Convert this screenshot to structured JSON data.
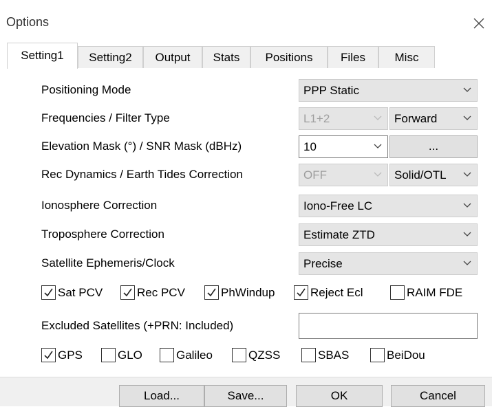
{
  "window": {
    "title": "Options"
  },
  "tabs": [
    "Setting1",
    "Setting2",
    "Output",
    "Stats",
    "Positions",
    "Files",
    "Misc"
  ],
  "settings": {
    "positioning_mode": {
      "label": "Positioning Mode",
      "value": "PPP Static"
    },
    "frequencies": {
      "label": "Frequencies / Filter Type",
      "freq_value": "L1+2",
      "filter_value": "Forward"
    },
    "elevation": {
      "label": "Elevation Mask (°) / SNR Mask (dBHz)",
      "value": "10",
      "snr_button": "..."
    },
    "dynamics": {
      "label": "Rec Dynamics / Earth Tides Correction",
      "dyn_value": "OFF",
      "tides_value": "Solid/OTL"
    },
    "ionosphere": {
      "label": "Ionosphere Correction",
      "value": "Iono-Free LC"
    },
    "troposphere": {
      "label": "Troposphere Correction",
      "value": "Estimate ZTD"
    },
    "ephemeris": {
      "label": "Satellite Ephemeris/Clock",
      "value": "Precise"
    }
  },
  "options_checks": [
    {
      "label": "Sat PCV",
      "checked": true
    },
    {
      "label": "Rec PCV",
      "checked": true
    },
    {
      "label": "PhWindup",
      "checked": true
    },
    {
      "label": "Reject Ecl",
      "checked": true
    },
    {
      "label": "RAIM FDE",
      "checked": false
    }
  ],
  "excluded": {
    "label": "Excluded Satellites (+PRN: Included)",
    "value": ""
  },
  "systems": [
    {
      "label": "GPS",
      "checked": true
    },
    {
      "label": "GLO",
      "checked": false
    },
    {
      "label": "Galileo",
      "checked": false
    },
    {
      "label": "QZSS",
      "checked": false
    },
    {
      "label": "SBAS",
      "checked": false
    },
    {
      "label": "BeiDou",
      "checked": false
    }
  ],
  "buttons": {
    "load": "Load...",
    "save": "Save...",
    "ok": "OK",
    "cancel": "Cancel"
  }
}
